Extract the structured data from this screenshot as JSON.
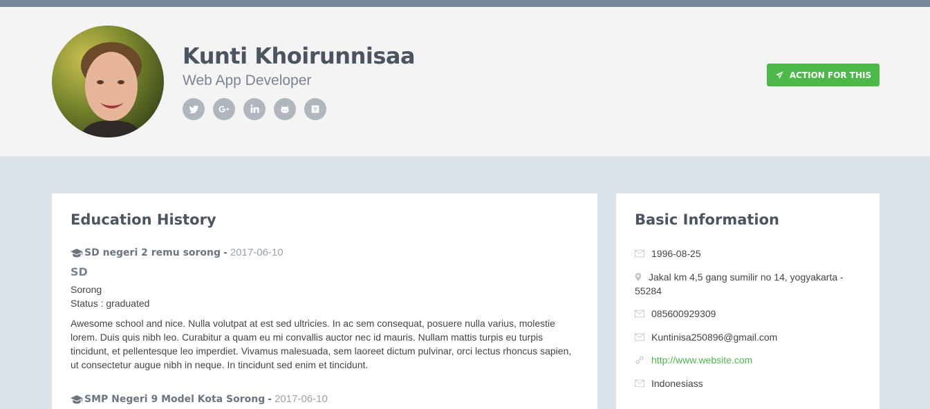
{
  "profile": {
    "name": "Kunti Khoirunnisaa",
    "role": "Web App Developer",
    "socials": [
      {
        "icon": "twitter-icon"
      },
      {
        "icon": "google-plus-icon"
      },
      {
        "icon": "linkedin-icon"
      },
      {
        "icon": "github-icon"
      },
      {
        "icon": "y-combinator-icon"
      }
    ],
    "action_label": "ACTION FOR THIS"
  },
  "education": {
    "title": "Education History",
    "entries": [
      {
        "school": "SD negeri 2 remu sorong",
        "separator": "-",
        "date": "2017-06-10",
        "level": "SD",
        "city": "Sorong",
        "status": "Status : graduated",
        "description": "Awesome school and nice. Nulla volutpat at est sed ultricies. In ac sem consequat, posuere nulla varius, molestie lorem. Duis quis nibh leo. Curabitur a quam eu mi convallis auctor nec id mauris. Nullam mattis turpis eu turpis tincidunt, et pellentesque leo imperdiet. Vivamus malesuada, sem laoreet dictum pulvinar, orci lectus rhoncus sapien, ut consectetur augue nibh in neque. In tincidunt sed enim et tincidunt."
      },
      {
        "school": "SMP Negeri 9 Model Kota Sorong",
        "separator": "-",
        "date": "2017-06-10"
      }
    ]
  },
  "basic_info": {
    "title": "Basic Information",
    "birthdate": "1996-08-25",
    "address": "Jakal km 4,5 gang sumilir no 14, yogyakarta - 55284",
    "phone": "085600929309",
    "email": "Kuntinisa250896@gmail.com",
    "website": "http://www.website.com",
    "country": "Indonesiass"
  },
  "colors": {
    "accent_green": "#4cb848",
    "top_bar": "#77879a",
    "page_bg": "#dae2e7",
    "header_bg": "#f4f4f4"
  }
}
